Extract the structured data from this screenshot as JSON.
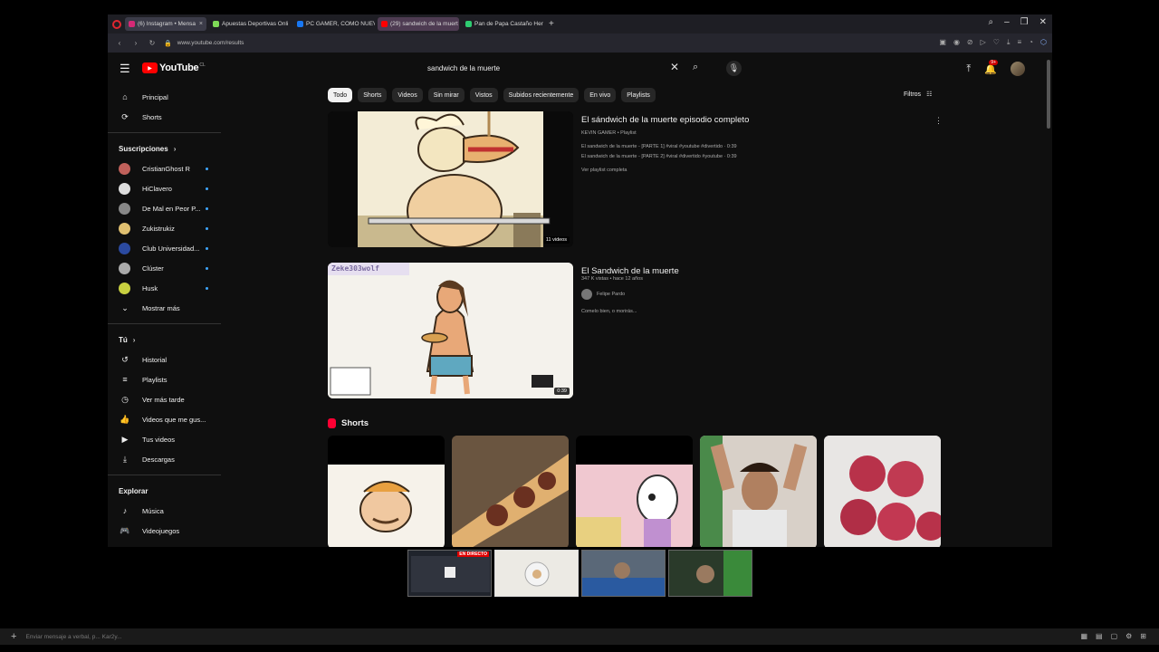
{
  "browser": {
    "tabs": [
      {
        "label": "(6) Instagram • Mensa",
        "fav_color": "#d62976",
        "active": true
      },
      {
        "label": "Apuestas Deportivas Onli",
        "fav_color": "#7ed957",
        "active": false
      },
      {
        "label": "PC GAMER, COMO NUEVA",
        "fav_color": "#1877f2",
        "active": false
      },
      {
        "label": "(29) sandwich de la muert",
        "fav_color": "#ff0000",
        "active": false,
        "highlight": true
      },
      {
        "label": "Pan de Papa Castaño Her",
        "fav_color": "#2ecc71",
        "active": false
      }
    ],
    "url": "www.youtube.com/results"
  },
  "youtube": {
    "logo_text": "YouTube",
    "country": "CL",
    "search_query": "sandwich de la muerte",
    "notifications": "9+"
  },
  "sidebar": {
    "main": [
      {
        "label": "Principal",
        "icon": "home-icon",
        "glyph": "⌂"
      },
      {
        "label": "Shorts",
        "icon": "shorts-icon",
        "glyph": "⟳"
      }
    ],
    "subscriptions_title": "Suscripciones",
    "subscriptions": [
      {
        "label": "CristianGhost R",
        "color": "#c0605a"
      },
      {
        "label": "HiClavero",
        "color": "#dddddd"
      },
      {
        "label": "De Mal en Peor P...",
        "color": "#888888"
      },
      {
        "label": "Zukistrukiz",
        "color": "#e0c070"
      },
      {
        "label": "Club Universidad...",
        "color": "#2b4aa0"
      },
      {
        "label": "Clúster",
        "color": "#aaaaaa"
      },
      {
        "label": "Husk",
        "color": "#c8d040"
      }
    ],
    "show_more": "Mostrar más",
    "you_title": "Tú",
    "you": [
      {
        "label": "Historial",
        "icon": "history-icon",
        "glyph": "↺"
      },
      {
        "label": "Playlists",
        "icon": "playlists-icon",
        "glyph": "≡"
      },
      {
        "label": "Ver más tarde",
        "icon": "watch-later-icon",
        "glyph": "◷"
      },
      {
        "label": "Videos que me gus...",
        "icon": "like-icon",
        "glyph": "👍"
      },
      {
        "label": "Tus videos",
        "icon": "your-videos-icon",
        "glyph": "▶"
      },
      {
        "label": "Descargas",
        "icon": "download-icon",
        "glyph": "⤓"
      }
    ],
    "explore_title": "Explorar",
    "explore": [
      {
        "label": "Música",
        "icon": "music-icon",
        "glyph": "♪"
      },
      {
        "label": "Videojuegos",
        "icon": "gaming-icon",
        "glyph": "🎮"
      },
      {
        "label": "Noticias",
        "icon": "news-icon",
        "glyph": "▤"
      }
    ]
  },
  "chips": [
    "Todo",
    "Shorts",
    "Videos",
    "Sin mirar",
    "Vistos",
    "Subidos recientemente",
    "En vivo",
    "Playlists"
  ],
  "filters_label": "Filtros",
  "results": [
    {
      "title": "El sándwich de la muerte episodio completo",
      "meta": "KEVIN GAMER • Playlist",
      "line1": "El sandwich de la muerte - [PARTE 1] #viral #youtube #divertido · 0:39",
      "line2": "El sandwich de la muerte - [PARTE 2] #viral #divertido #youtube · 0:39",
      "more": "Ver playlist completa",
      "count": "11 videos"
    },
    {
      "title": "El Sandwich de la muerte",
      "meta": "347 K vistas • hace 12 años",
      "channel": "Felipe Pardo",
      "desc": "Comelo bien, o morirás...",
      "watermark": "Zeke303wolf",
      "duration": "0:39"
    }
  ],
  "shorts_title": "Shorts",
  "stream": {
    "live_label": "EN DIRECTO",
    "chat_placeholder": "Enviar mensaje a verbal, p... Kar2y..."
  }
}
